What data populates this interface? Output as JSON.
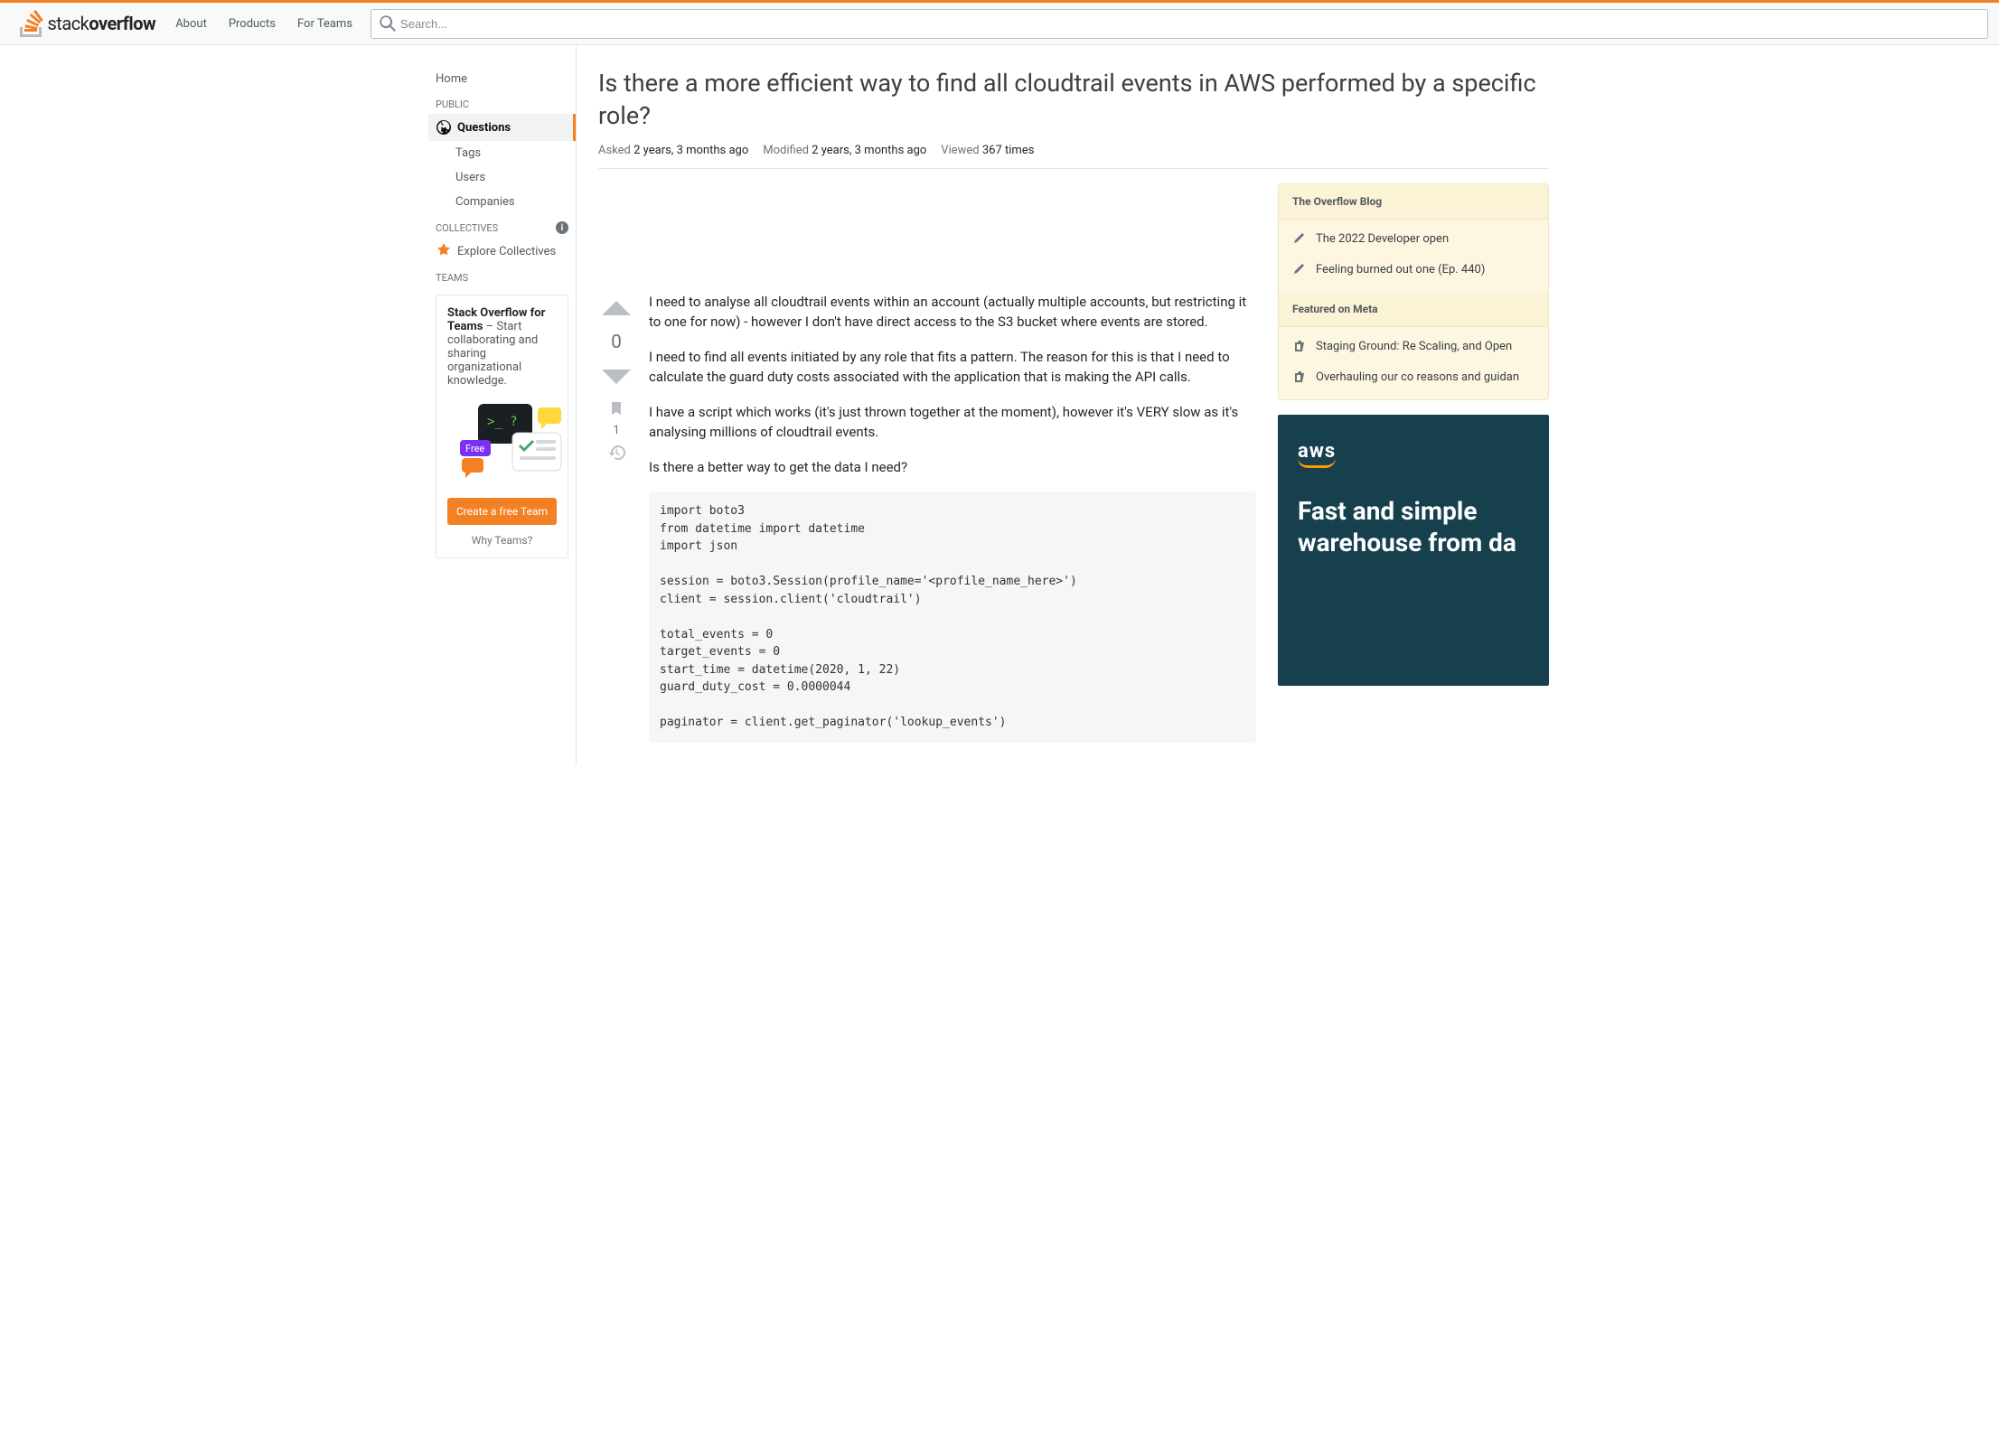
{
  "header": {
    "brand_left": "stack",
    "brand_right": "overflow",
    "nav": {
      "about": "About",
      "products": "Products",
      "for_teams": "For Teams"
    },
    "search_placeholder": "Search..."
  },
  "sidebar": {
    "home": "Home",
    "public_label": "PUBLIC",
    "items": [
      {
        "label": "Questions"
      },
      {
        "label": "Tags"
      },
      {
        "label": "Users"
      },
      {
        "label": "Companies"
      }
    ],
    "collectives_label": "COLLECTIVES",
    "explore_collectives": "Explore Collectives",
    "teams_label": "TEAMS",
    "teams_card": {
      "bold": "Stack Overflow for Teams",
      "rest": " – Start collaborating and sharing organizational knowledge.",
      "free_badge": "Free",
      "cta": "Create a free Team",
      "why": "Why Teams?"
    }
  },
  "question": {
    "title": "Is there a more efficient way to find all cloudtrail events in AWS performed by a specific role?",
    "asked_label": "Asked",
    "asked_value": "2 years, 3 months ago",
    "modified_label": "Modified",
    "modified_value": "2 years, 3 months ago",
    "viewed_label": "Viewed",
    "viewed_value": "367 times",
    "vote_count": "0",
    "follow_count": "1",
    "body": {
      "p1": "I need to analyse all cloudtrail events within an account (actually multiple accounts, but restricting it to one for now) - however I don't have direct access to the S3 bucket where events are stored.",
      "p2": "I need to find all events initiated by any role that fits a pattern. The reason for this is that I need to calculate the guard duty costs associated with the application that is making the API calls.",
      "p3": "I have a script which works (it's just thrown together at the moment), however it's VERY slow as it's analysing millions of cloudtrail events.",
      "p4": "Is there a better way to get the data I need?",
      "code": "import boto3\nfrom datetime import datetime\nimport json\n\nsession = boto3.Session(profile_name='<profile_name_here>')\nclient = session.client('cloudtrail')\n\ntotal_events = 0\ntarget_events = 0\nstart_time = datetime(2020, 1, 22)\nguard_duty_cost = 0.0000044\n\npaginator = client.get_paginator('lookup_events')"
    }
  },
  "right": {
    "blog_header": "The Overflow Blog",
    "blog_items": [
      "The 2022 Developer open",
      "Feeling burned out one (Ep. 440)"
    ],
    "meta_header": "Featured on Meta",
    "meta_items": [
      "Staging Ground: Re Scaling, and Open",
      "Overhauling our co reasons and guidan"
    ],
    "aws_ad": {
      "logo": "aws",
      "headline": "Fast and simple warehouse from da"
    }
  }
}
